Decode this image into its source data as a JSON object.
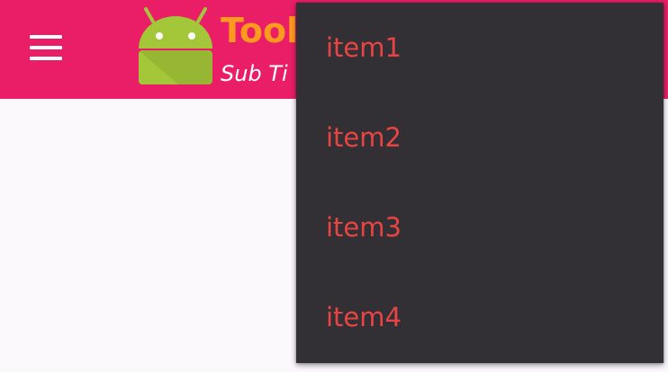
{
  "toolbar": {
    "title": "Tooll",
    "subtitle": "Sub Ti",
    "nav_icon": "menu-icon",
    "logo_icon": "android-logo-icon",
    "colors": {
      "background": "#ea1d67",
      "title": "#ff9a1f",
      "subtitle": "#ffffff"
    }
  },
  "overflow_menu": {
    "items": [
      {
        "label": "item1"
      },
      {
        "label": "item2"
      },
      {
        "label": "item3"
      },
      {
        "label": "item4"
      }
    ],
    "colors": {
      "background": "#323034",
      "text": "#e94444"
    }
  }
}
